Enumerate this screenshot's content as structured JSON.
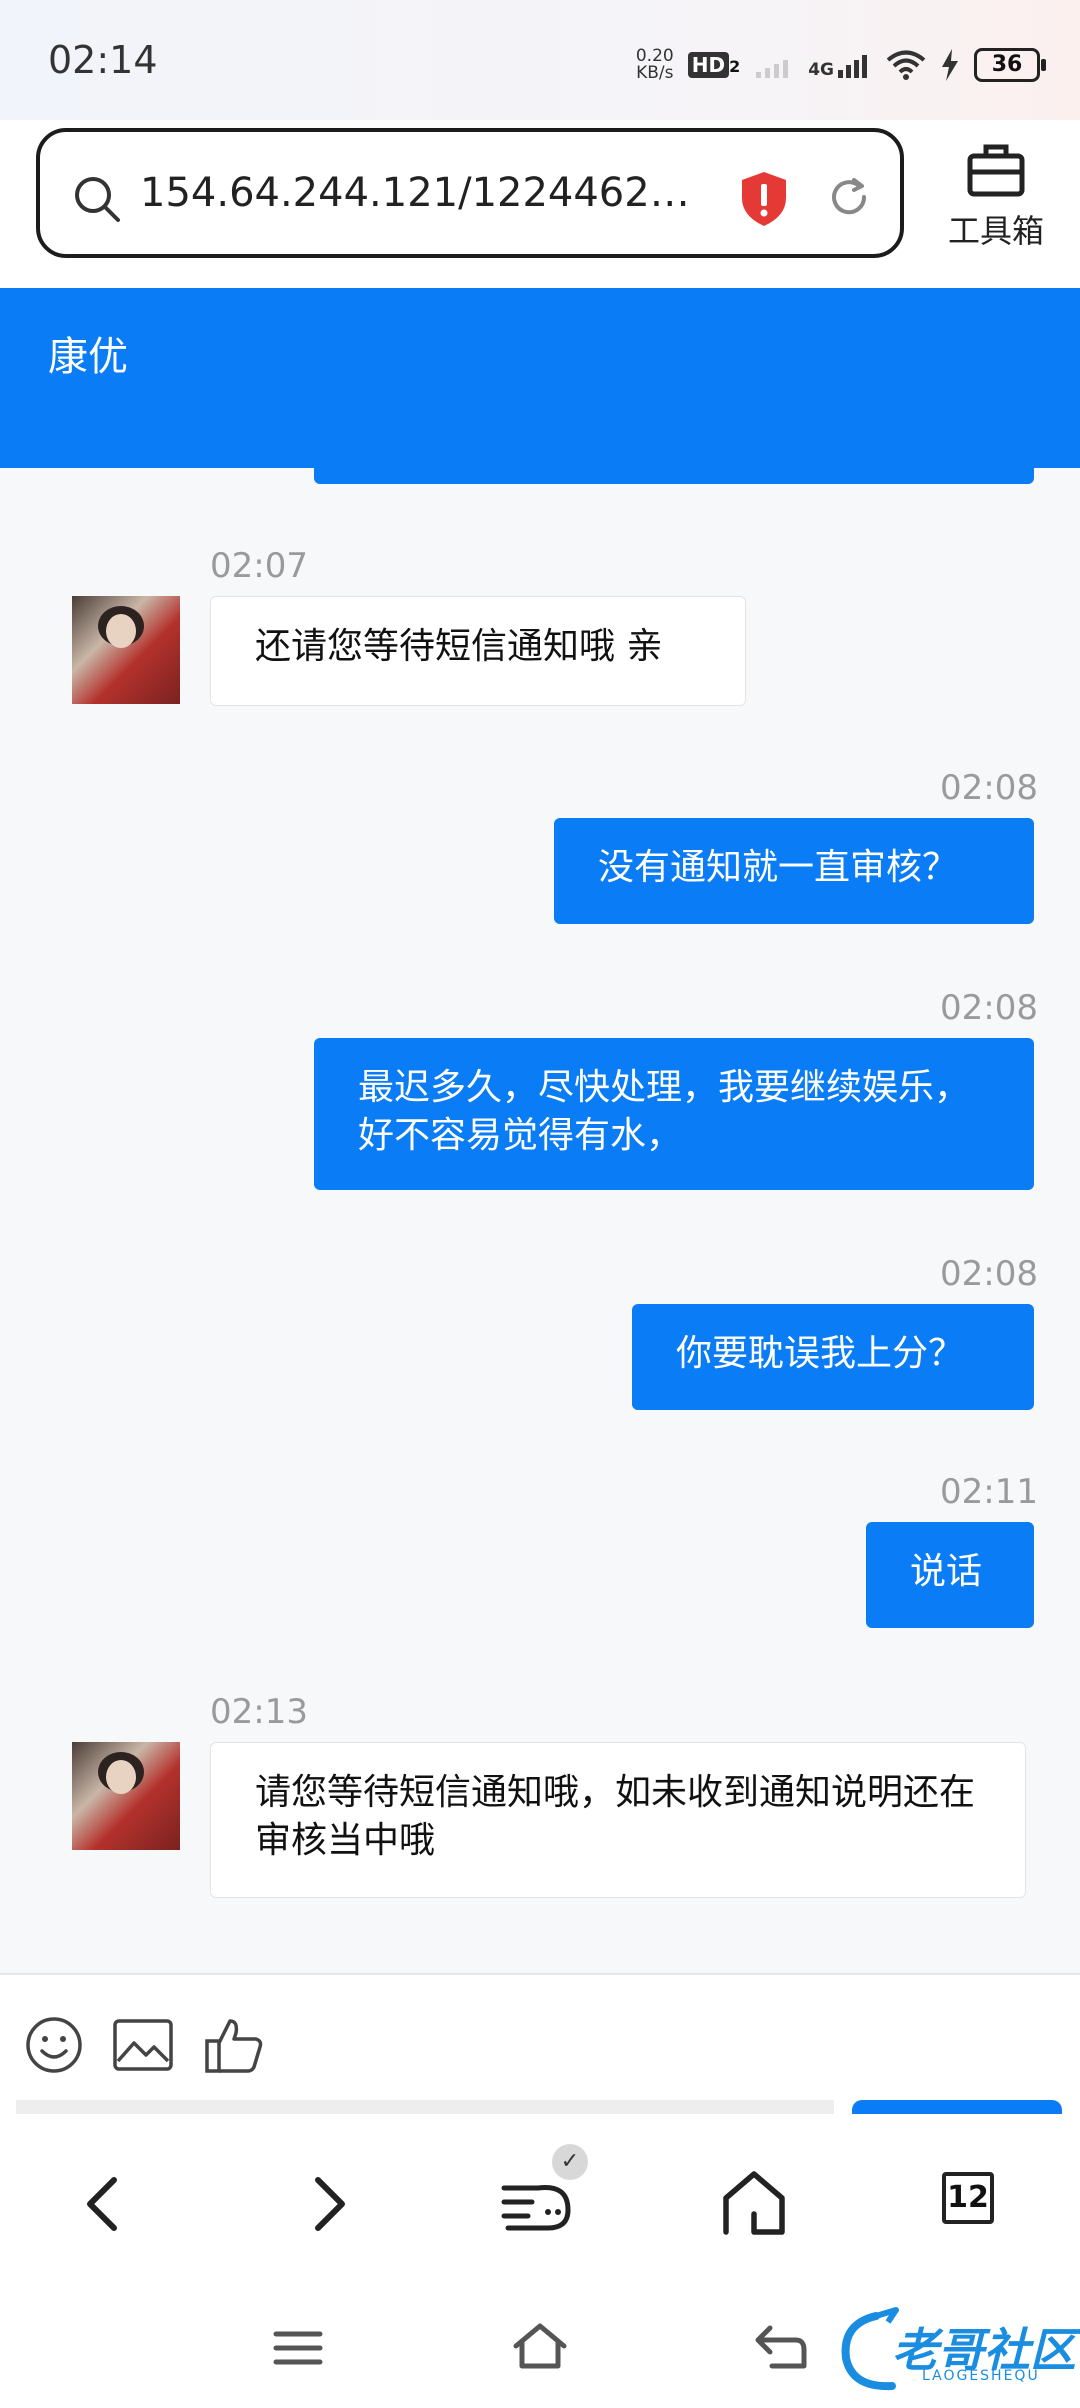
{
  "status_bar": {
    "time": "02:14",
    "net_speed_value": "0.20",
    "net_speed_unit": "KB/s",
    "hd_label": "HD",
    "hd_sub": "2",
    "network_type": "4G",
    "battery": "36"
  },
  "browser": {
    "url": "154.64.244.121/1224462…",
    "toolbox_label": "工具箱"
  },
  "chat": {
    "title": "康优",
    "messages": [
      {
        "time": "02:07",
        "direction": "in",
        "text": "还请您等待短信通知哦 亲"
      },
      {
        "time": "02:08",
        "direction": "out",
        "text": "没有通知就一直审核？"
      },
      {
        "time": "02:08",
        "direction": "out",
        "text": "最迟多久，尽快处理，我要继续娱乐，好不容易觉得有水，"
      },
      {
        "time": "02:08",
        "direction": "out",
        "text": "你要耽误我上分？"
      },
      {
        "time": "02:11",
        "direction": "out",
        "text": "说话"
      },
      {
        "time": "02:13",
        "direction": "in",
        "text": "请您等待短信通知哦，如未收到通知说明还在审核当中哦"
      }
    ]
  },
  "bottom_nav": {
    "tab_count": "12"
  },
  "watermark": {
    "text": "老哥社区",
    "sub": "LAOGESHEQU"
  },
  "colors": {
    "brand_blue": "#0a7cf5",
    "chat_bg": "#f7f8fa"
  }
}
